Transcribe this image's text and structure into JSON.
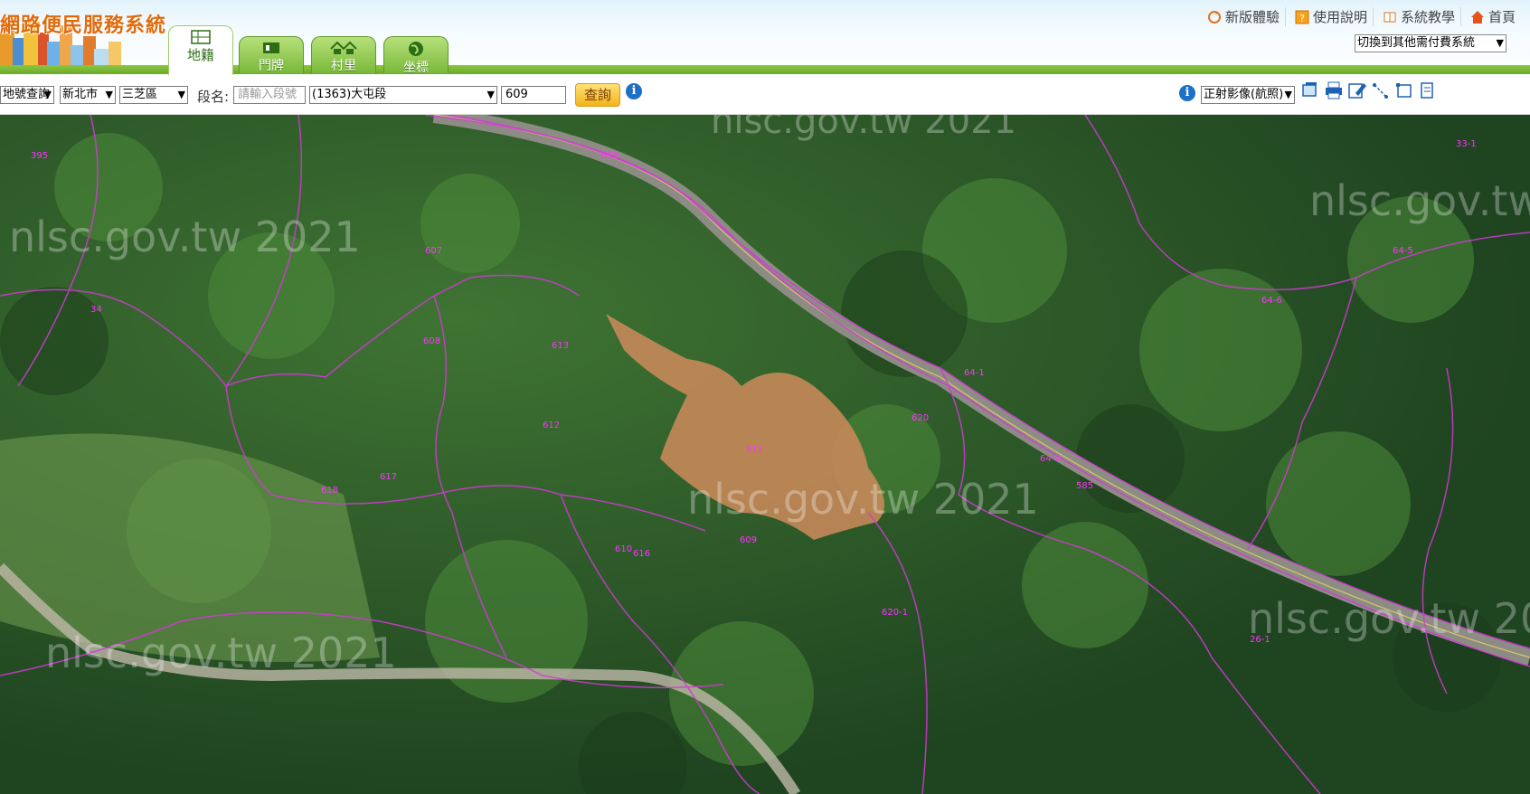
{
  "header": {
    "app_title": "網路便民服務系統",
    "top_links": [
      {
        "label": "新版體驗",
        "icon": "refresh-icon"
      },
      {
        "label": "使用說明",
        "icon": "help-icon"
      },
      {
        "label": "系統教學",
        "icon": "book-icon"
      },
      {
        "label": "首頁",
        "icon": "home-icon"
      }
    ],
    "switch_system": "切換到其他需付費系統"
  },
  "tabs": [
    {
      "label": "地籍",
      "icon": "cadastre-icon",
      "active": true
    },
    {
      "label": "門牌",
      "icon": "door-plate-icon",
      "active": false
    },
    {
      "label": "村里",
      "icon": "village-icon",
      "active": false
    },
    {
      "label": "坐標",
      "icon": "globe-icon",
      "active": false
    }
  ],
  "toolbar": {
    "query_mode": "地號查詢",
    "city": "新北市",
    "district": "三芝區",
    "section_label": "段名:",
    "section_placeholder": "請輸入段號",
    "section_select": "(1363)大屯段",
    "lot_number": "609",
    "query_button": "查詢",
    "basemap": "正射影像(航照)",
    "tools": [
      "layer-icon",
      "print-icon",
      "edit-icon",
      "measure-icon",
      "area-icon",
      "document-icon"
    ]
  },
  "map": {
    "watermark": "nlsc.gov.tw 2021",
    "parcel_labels": [
      "395",
      "607",
      "608",
      "612",
      "610",
      "609",
      "611",
      "613",
      "616",
      "617",
      "618",
      "619",
      "620",
      "64-1",
      "64-3",
      "64-5",
      "64-6",
      "33-1",
      "34",
      "26-1",
      "585",
      "620-1"
    ],
    "colors": {
      "parcel_line": "#d438d8",
      "label": "#ff33ff",
      "highlight_fill": "#c98a5a"
    }
  }
}
